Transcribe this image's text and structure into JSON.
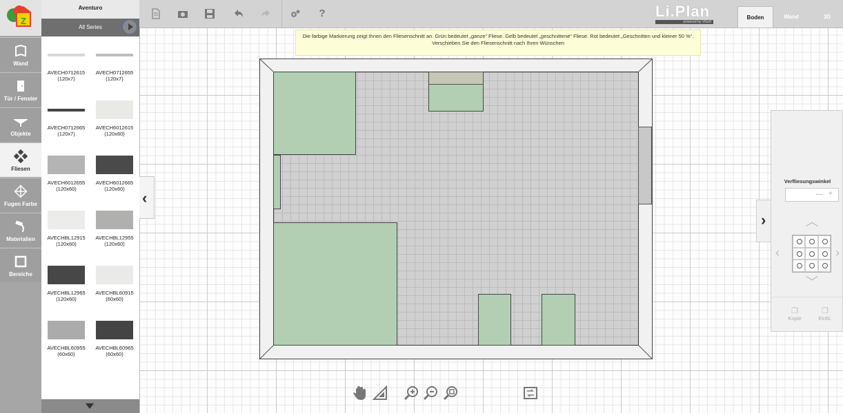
{
  "catalog": {
    "title": "Aventuro",
    "series": "All Series",
    "tiles": [
      {
        "code": "AVECH0712615",
        "size": "(120x7)",
        "color": "#d8d8d8"
      },
      {
        "code": "AVECH0712655",
        "size": "(120x7)",
        "color": "#bdbdbd"
      },
      {
        "code": "AVECH0712665",
        "size": "(120x7)",
        "color": "#444444"
      },
      {
        "code": "AVECH6012615",
        "size": "(120x60)",
        "color": "#e9e9e6"
      },
      {
        "code": "AVECH6012655",
        "size": "(120x60)",
        "color": "#b4b4b4"
      },
      {
        "code": "AVECH6012665",
        "size": "(120x60)",
        "color": "#4a4a4a"
      },
      {
        "code": "AVECHBL12915",
        "size": "(120x60)",
        "color": "#ececea"
      },
      {
        "code": "AVECHBL12955",
        "size": "(120x60)",
        "color": "#b0b0ae"
      },
      {
        "code": "AVECHBL12965",
        "size": "(120x60)",
        "color": "#474747"
      },
      {
        "code": "AVECHBL60915",
        "size": "(60x60)",
        "color": "#eaeae8"
      },
      {
        "code": "AVECHBL60955",
        "size": "(60x60)",
        "color": "#ababab"
      },
      {
        "code": "AVECHBL60965",
        "size": "(60x60)",
        "color": "#444444"
      }
    ]
  },
  "nav": {
    "items": [
      {
        "label": "Wand"
      },
      {
        "label": "Tür / Fenster"
      },
      {
        "label": "Objekte"
      },
      {
        "label": "Fliesen"
      },
      {
        "label": "Fugen Farbe"
      },
      {
        "label": "Materialien"
      },
      {
        "label": "Bereiche"
      }
    ]
  },
  "brand": {
    "name": "Li.Plan",
    "sub": "powered by ViSoft"
  },
  "tabs": [
    {
      "label": "Boden",
      "active": true
    },
    {
      "label": "Wand",
      "active": false
    },
    {
      "label": "3D",
      "active": false
    }
  ],
  "hint": "Die farbige Markierung zeigt Ihnen den Fliesenschnitt an. Grün bedeutet „ganze“ Fliese. Gelb bedeutet „geschnittene“ Fliese. Rot bedeutet „Geschnitten und kleiner 50 %“. Verschieben Sie den Fliesenschnitt nach Ihren Wünschen",
  "rightpanel": {
    "label": "Verfliesungswinkel",
    "minus": "—",
    "plus": "+",
    "copy": "Kopie",
    "paste": "Einfü."
  },
  "toolbar": {
    "help": "?"
  },
  "colors": {
    "green_tile": "#b2cfb4",
    "floor_grey": "#d0d0d0",
    "hint_bg": "#fdfdd8"
  }
}
